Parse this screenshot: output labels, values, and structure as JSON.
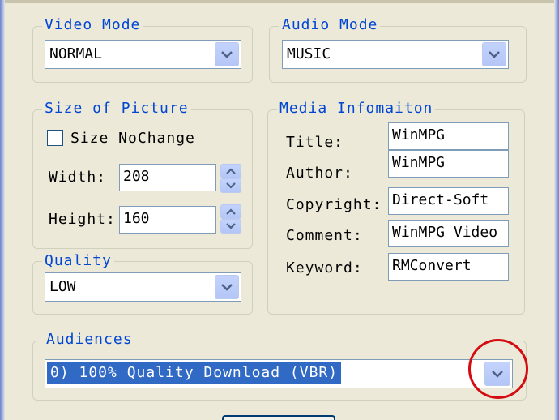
{
  "video_mode": {
    "legend": "Video Mode",
    "value": "NORMAL",
    "icon": "chevron-down-icon"
  },
  "audio_mode": {
    "legend": "Audio Mode",
    "value": "MUSIC",
    "icon": "chevron-down-icon"
  },
  "size_of_picture": {
    "legend": "Size of Picture",
    "size_nochange_label": "Size NoChange",
    "size_nochange_checked": false,
    "width_label": "Width:",
    "width_value": "208",
    "height_label": "Height:",
    "height_value": "160"
  },
  "quality": {
    "legend": "Quality",
    "value": "LOW"
  },
  "media_info": {
    "legend": "Media Infomaiton",
    "title_label": "Title:",
    "title_value": "WinMPG",
    "author_label": "Author:",
    "author_value": "WinMPG",
    "copyright_label": "Copyright:",
    "copyright_value": "Direct-Soft",
    "comment_label": "Comment:",
    "comment_value": "WinMPG Video",
    "keyword_label": "Keyword:",
    "keyword_value": "RMConvert"
  },
  "audiences": {
    "legend": "Audiences",
    "value": "0) 100% Quality Download (VBR)"
  },
  "colors": {
    "legend": "#0046d5",
    "selection": "#316ac5",
    "highlight_circle": "#d40c12",
    "dialog_bg": "#ece9d8"
  }
}
